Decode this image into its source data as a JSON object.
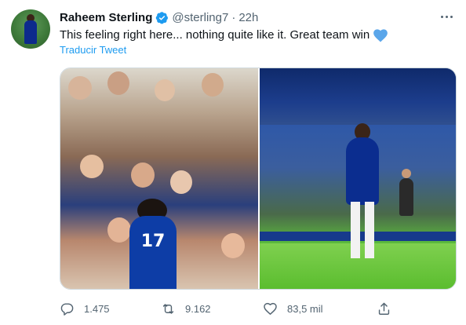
{
  "author": {
    "name": "Raheem Sterling",
    "handle": "@sterling7",
    "time": "22h",
    "separator": "·",
    "avatar_icon": "avatar-photo",
    "verified_icon": "verified-badge-icon"
  },
  "tweet": {
    "text": "This feeling right here... nothing quite like it. Great team win",
    "emoji": "blue-heart",
    "translate_link": "Traducir Tweet"
  },
  "media": {
    "left_photo": {
      "jersey_number": "17"
    },
    "right_photo": {}
  },
  "actions": {
    "reply": {
      "icon": "reply-icon",
      "count": "1.475"
    },
    "retweet": {
      "icon": "retweet-icon",
      "count": "9.162"
    },
    "like": {
      "icon": "heart-outline-icon",
      "count": "83,5 mil"
    },
    "share": {
      "icon": "share-icon"
    }
  },
  "colors": {
    "link": "#1d9bf0",
    "secondary_text": "#536471",
    "verified": "#1d9bf0",
    "heart_emoji": "#5aa6ea"
  }
}
